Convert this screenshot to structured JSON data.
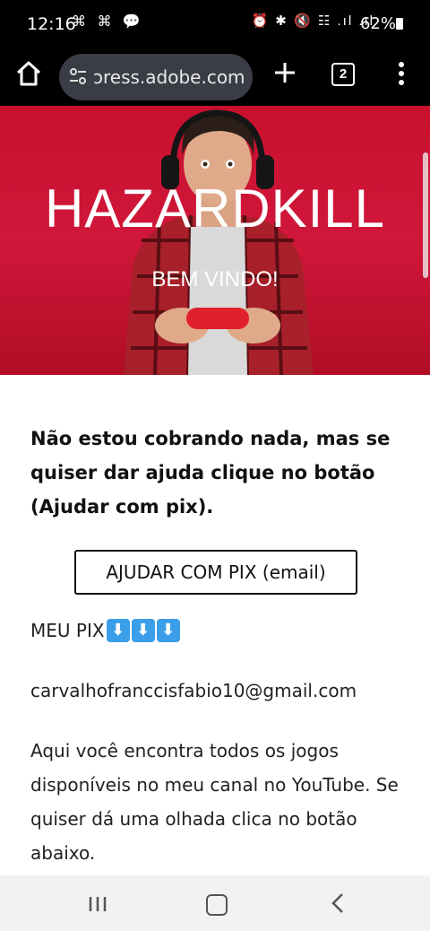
{
  "status_bar": {
    "time": "12:16",
    "notifications": "⌘ ⌘ 💬",
    "system_icons": "⏰ ✱ 🔇 ☷ .ıl .ıl",
    "battery": "62%"
  },
  "browser": {
    "url": "ɔress.adobe.com",
    "tab_count": "2"
  },
  "hero": {
    "title": "HAZARDKILL",
    "subtitle": "BEM VINDO!"
  },
  "content": {
    "intro_bold": "Não estou cobrando nada, mas se quiser dar ajuda clique no botão (Ajudar com pix).",
    "pix_button_label": "AJUDAR COM PIX (email)",
    "pix_label": "MEU PIX",
    "pix_arrows": [
      "⬇",
      "⬇",
      "⬇"
    ],
    "email": "carvalhofranccisfabio10@gmail.com",
    "description": "Aqui você encontra todos os jogos disponíveis no meu canal no YouTube. Se quiser dá uma olhada clica no botão abaixo."
  },
  "colors": {
    "hero_red": "#c8102e",
    "arrow_blue": "#3b9ee8",
    "url_pill": "#3a3d45"
  }
}
